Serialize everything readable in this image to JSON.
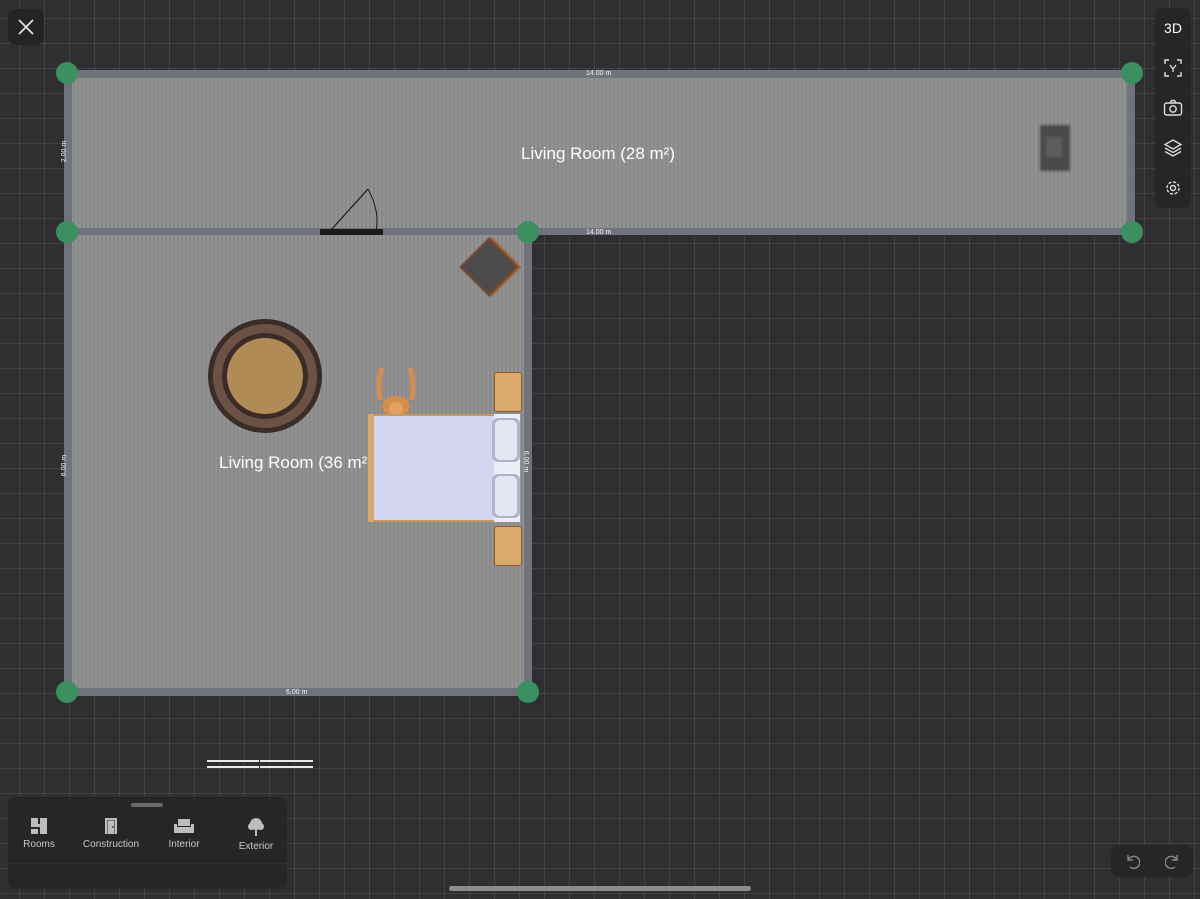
{
  "toolbar_top": {
    "view_3d_label": "3D"
  },
  "rooms": [
    {
      "name": "Living Room (28 m²)"
    },
    {
      "name": "Living Room (36 m²"
    }
  ],
  "dimensions": {
    "top_wall": "14.00 m",
    "mid_wall": "14.00 m",
    "left_upper": "2.00 m",
    "left_lower": "6.00 m",
    "right_lower": "6.00 m",
    "bottom_wall": "6.00 m"
  },
  "bottom_panel": {
    "tools": [
      {
        "label": "Rooms",
        "icon": "rooms-icon"
      },
      {
        "label": "Construction",
        "icon": "door-icon"
      },
      {
        "label": "Interior",
        "icon": "armchair-icon"
      },
      {
        "label": "Exterior",
        "icon": "tree-icon"
      }
    ]
  },
  "colors": {
    "canvas": "#2f2f31",
    "floor": "#8d8d8d",
    "wall": "#6f737c",
    "node": "#3c8f5e",
    "bed": "#d4d5f0",
    "wood": "#dca46a"
  }
}
